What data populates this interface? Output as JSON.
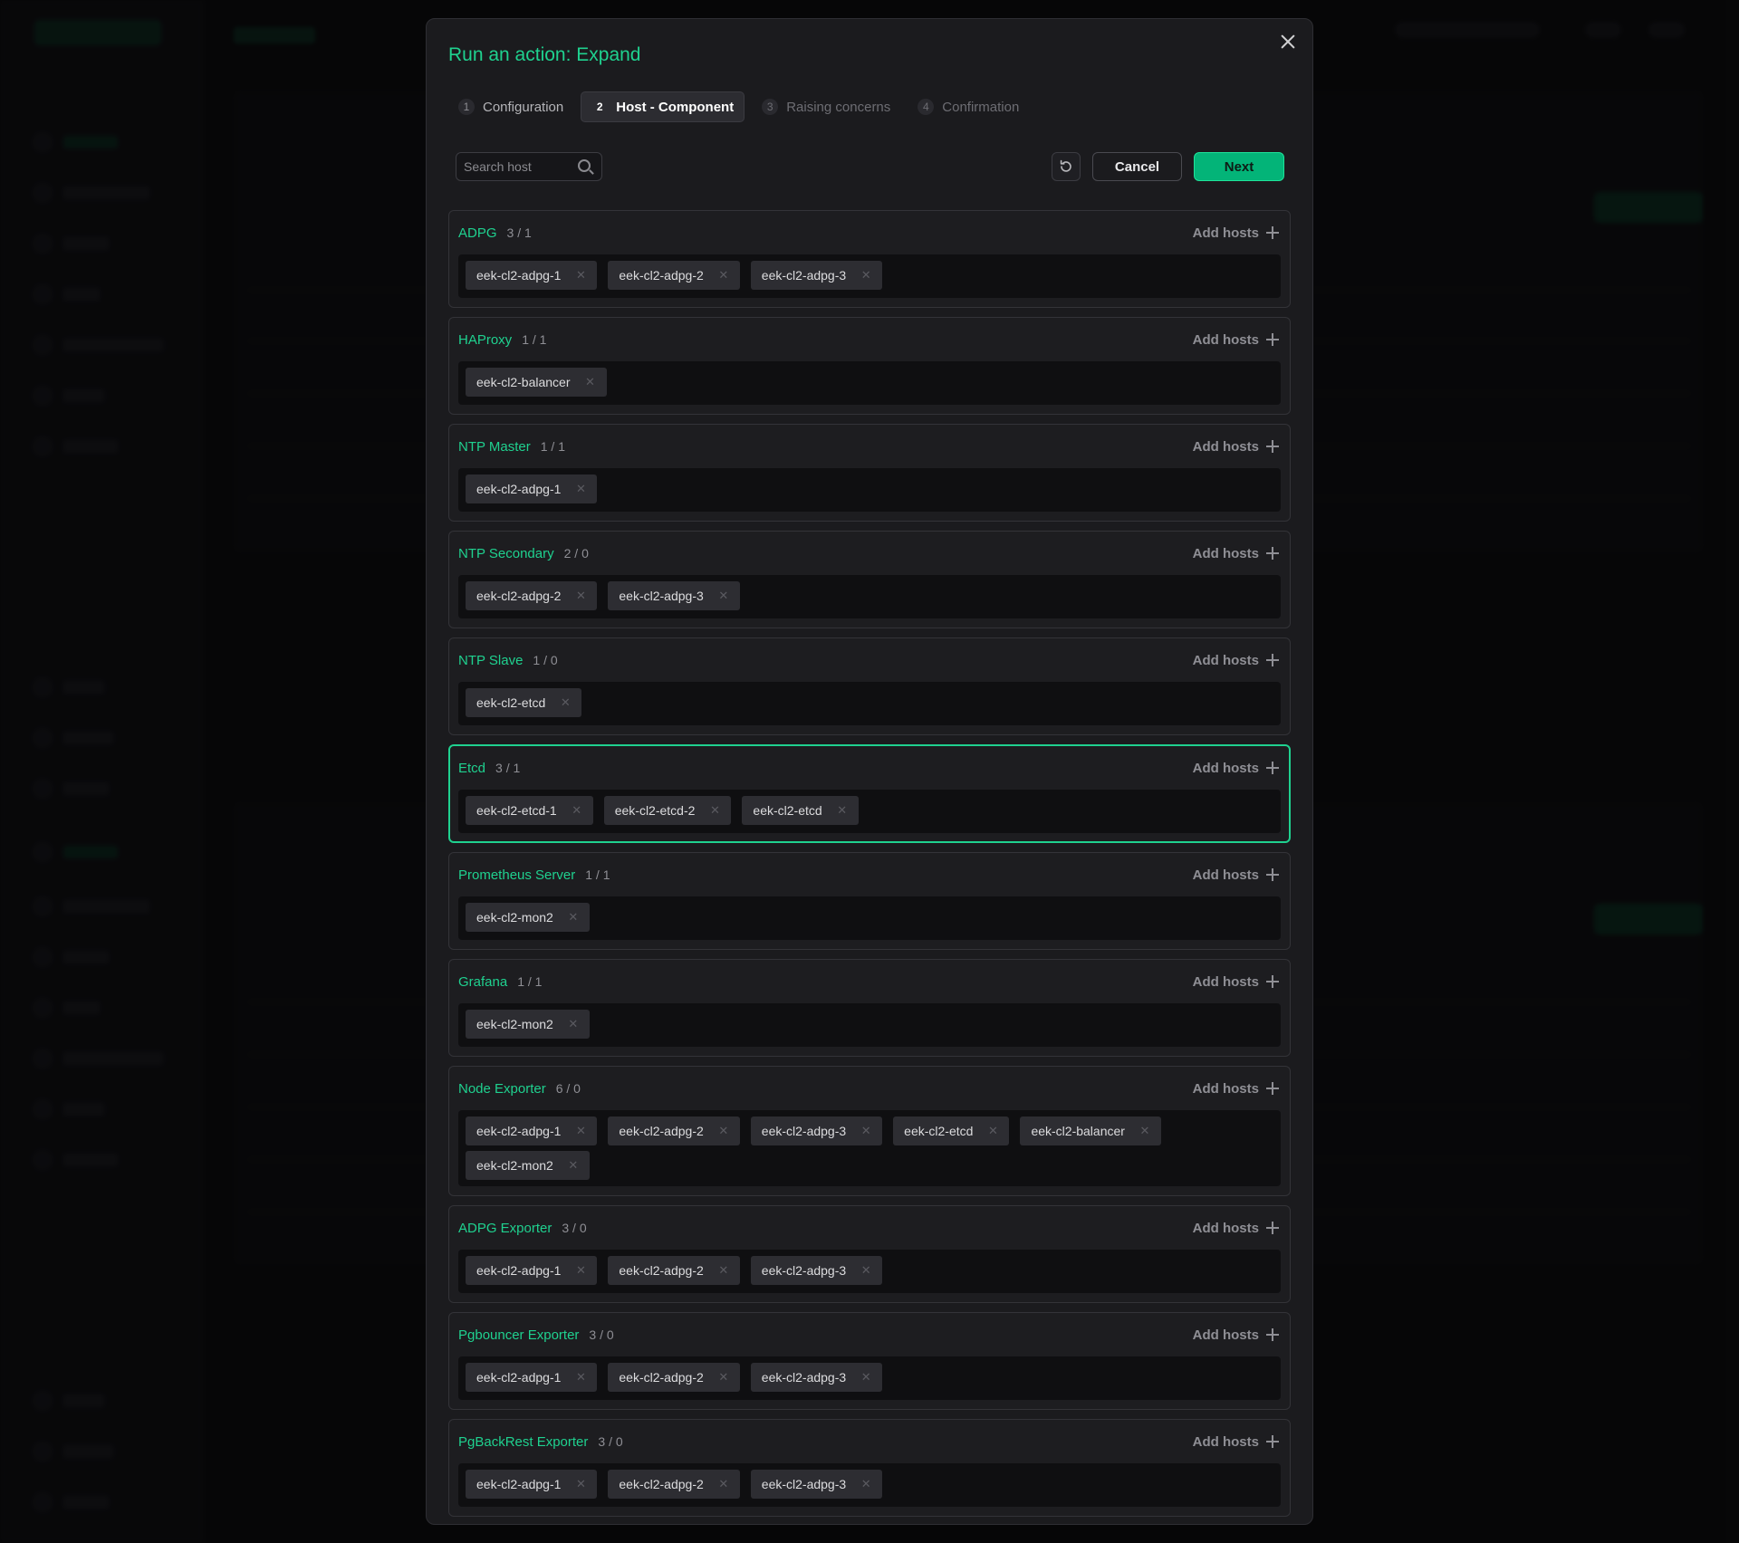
{
  "modal": {
    "title": "Run an action: Expand",
    "steps": [
      {
        "num": "1",
        "label": "Configuration"
      },
      {
        "num": "2",
        "label": "Host - Component"
      },
      {
        "num": "3",
        "label": "Raising concerns"
      },
      {
        "num": "4",
        "label": "Confirmation"
      }
    ],
    "search_placeholder": "Search host",
    "cancel_label": "Cancel",
    "next_label": "Next",
    "add_hosts_label": "Add hosts",
    "groups": [
      {
        "name": "ADPG",
        "count": "3 / 1",
        "hosts": [
          "eek-cl2-adpg-1",
          "eek-cl2-adpg-2",
          "eek-cl2-adpg-3"
        ]
      },
      {
        "name": "HAProxy",
        "count": "1 / 1",
        "hosts": [
          "eek-cl2-balancer"
        ]
      },
      {
        "name": "NTP Master",
        "count": "1 / 1",
        "hosts": [
          "eek-cl2-adpg-1"
        ]
      },
      {
        "name": "NTP Secondary",
        "count": "2 / 0",
        "hosts": [
          "eek-cl2-adpg-2",
          "eek-cl2-adpg-3"
        ]
      },
      {
        "name": "NTP Slave",
        "count": "1 / 0",
        "hosts": [
          "eek-cl2-etcd"
        ]
      },
      {
        "name": "Etcd",
        "count": "3 / 1",
        "hosts": [
          "eek-cl2-etcd-1",
          "eek-cl2-etcd-2",
          "eek-cl2-etcd"
        ],
        "selected": true
      },
      {
        "name": "Prometheus Server",
        "count": "1 / 1",
        "hosts": [
          "eek-cl2-mon2"
        ]
      },
      {
        "name": "Grafana",
        "count": "1 / 1",
        "hosts": [
          "eek-cl2-mon2"
        ]
      },
      {
        "name": "Node Exporter",
        "count": "6 / 0",
        "hosts": [
          "eek-cl2-adpg-1",
          "eek-cl2-adpg-2",
          "eek-cl2-adpg-3",
          "eek-cl2-etcd",
          "eek-cl2-balancer",
          "eek-cl2-mon2"
        ]
      },
      {
        "name": "ADPG Exporter",
        "count": "3 / 0",
        "hosts": [
          "eek-cl2-adpg-1",
          "eek-cl2-adpg-2",
          "eek-cl2-adpg-3"
        ]
      },
      {
        "name": "Pgbouncer Exporter",
        "count": "3 / 0",
        "hosts": [
          "eek-cl2-adpg-1",
          "eek-cl2-adpg-2",
          "eek-cl2-adpg-3"
        ]
      },
      {
        "name": "PgBackRest Exporter",
        "count": "3 / 0",
        "hosts": [
          "eek-cl2-adpg-1",
          "eek-cl2-adpg-2",
          "eek-cl2-adpg-3"
        ]
      }
    ]
  },
  "colors": {
    "accent": "#1fd18f",
    "primary_button": "#03b478",
    "background": "#1b1b1e"
  },
  "icons": {
    "close": "close-icon",
    "search": "search-icon",
    "reset": "reset-icon",
    "add": "plus-icon",
    "remove": "close-small-icon"
  }
}
